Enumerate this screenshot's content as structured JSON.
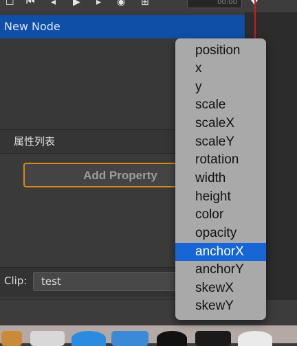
{
  "toolbar": {
    "timecode": "00:00",
    "icons": [
      "checkbox-icon",
      "rewind-icon",
      "step-back-icon",
      "play-icon",
      "step-forward-icon",
      "record-icon",
      "add-icon"
    ]
  },
  "node_list": {
    "selected_node": "New Node"
  },
  "properties_panel": {
    "header": "属性列表",
    "add_button_label": "Add Property"
  },
  "clip": {
    "label": "Clip:",
    "value": "test"
  },
  "dropdown": {
    "items": [
      "position",
      "x",
      "y",
      "scale",
      "scaleX",
      "scaleY",
      "rotation",
      "width",
      "height",
      "color",
      "opacity",
      "anchorX",
      "anchorY",
      "skewX",
      "skewY"
    ],
    "selected": "anchorX"
  },
  "colors": {
    "accent_blue": "#1666d8",
    "node_row_blue": "#0f4fa8",
    "add_button_border": "#d98a16",
    "playhead": "#c81e1e"
  }
}
